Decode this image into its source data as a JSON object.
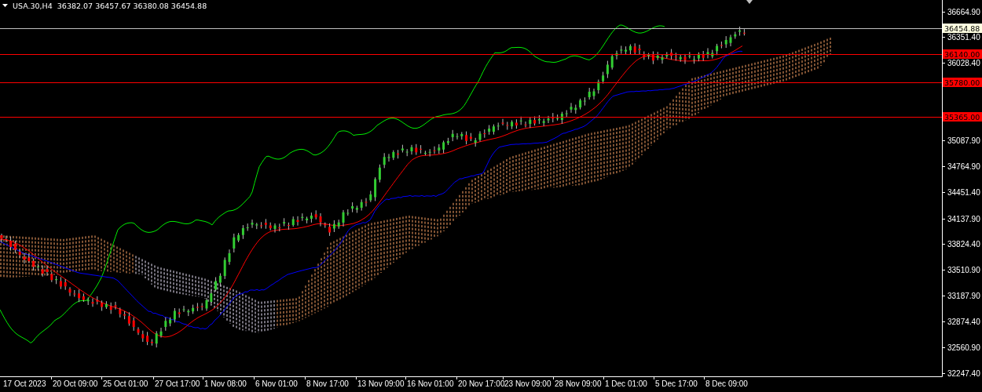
{
  "header": {
    "symbol": "USA.30,H4",
    "ohlc": "36382.07 36457.67 36380.08 36454.88"
  },
  "price_axis": [
    "36664.90",
    "36351.40",
    "36028.40",
    "35087.90",
    "34764.90",
    "34451.40",
    "34137.90",
    "33824.40",
    "33510.90",
    "33187.90",
    "32874.40",
    "32560.90",
    "32247.40"
  ],
  "time_axis": [
    "17 Oct 2023",
    "20 Oct 09:00",
    "25 Oct 01:00",
    "27 Oct 17:00",
    "1 Nov 08:00",
    "6 Nov 01:00",
    "8 Nov 17:00",
    "13 Nov 09:00",
    "16 Nov 01:00",
    "20 Nov 17:00",
    "23 Nov 09:00",
    "28 Nov 09:00",
    "1 Dec 01:00",
    "5 Dec 17:00",
    "8 Dec 09:00"
  ],
  "current_price": {
    "label": "36454.88"
  },
  "price_levels": [
    {
      "label": "36140.00"
    },
    {
      "label": "35780.00"
    },
    {
      "label": "35365.00"
    }
  ]
}
